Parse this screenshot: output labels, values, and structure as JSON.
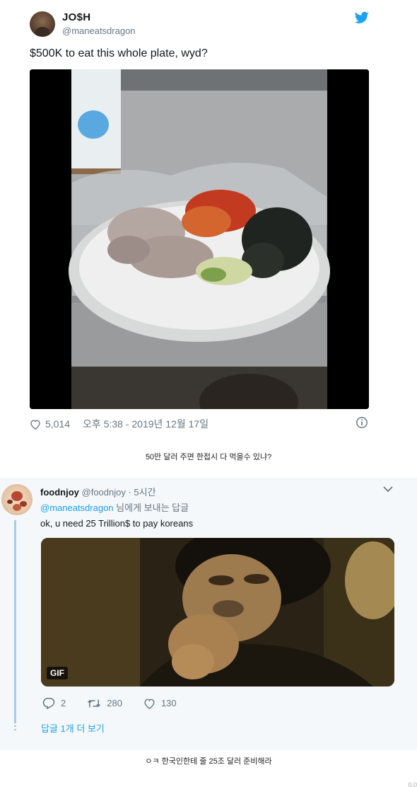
{
  "tweet1": {
    "name": "JO$H",
    "handle": "@maneatsdragon",
    "text": "$500K to eat this whole plate, wyd?",
    "likes": "5,014",
    "timestamp": "오후 5:38 - 2019년 12월 17일",
    "icons": {
      "brand": "twitter-bird-icon",
      "like": "heart-icon",
      "info": "info-icon"
    },
    "accent": "#1da1f2"
  },
  "caption1": "50만 달러 주면 한접시 다 먹을수 있냐?",
  "tweet2": {
    "name": "foodnjoy",
    "handle": "@foodnjoy",
    "time": " · 5시간",
    "reply_mention": "@maneatsdragon",
    "reply_suffix": " 님에게 보내는 답글",
    "text": "ok, u need 25 Trillion$ to pay koreans",
    "media_badge": "GIF",
    "replies": "2",
    "retweets": "280",
    "likes": "130",
    "more_replies": "답글 1개 더 보기",
    "icons": {
      "menu": "chevron-down-icon",
      "reply": "reply-icon",
      "retweet": "retweet-icon",
      "like": "heart-icon"
    }
  },
  "caption2": "ㅇㅋ 한국인한테 줄 25조 달러 준비해라",
  "corner_mark": "0.0"
}
